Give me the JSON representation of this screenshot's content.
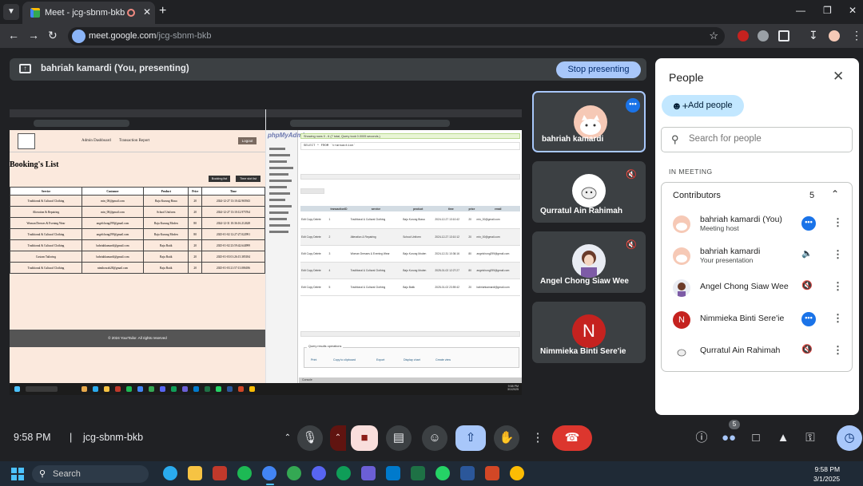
{
  "browser": {
    "tab_title": "Meet - jcg-sbnm-bkb",
    "url_host": "meet.google.com",
    "url_path": "/jcg-sbnm-bkb"
  },
  "presenting": {
    "text": "bahriah kamardi (You, presenting)",
    "stop_label": "Stop presenting"
  },
  "shared_screen": {
    "left_page": {
      "nav_items": [
        "Admin Dashboard",
        "Transaction Report"
      ],
      "logout": "Logout",
      "heading": "Booking's List",
      "buttons": [
        "Booking list",
        "Time slot list"
      ],
      "columns": [
        "Service",
        "Customer",
        "Product",
        "Price",
        "Time"
      ],
      "rows": [
        [
          "Traditional & Cultural Clothing",
          "min_00@gmail.com",
          "Baju Kurung Biasa",
          "20",
          "2024-12-27 13:10:42.965943"
        ],
        [
          "Alteration & Repairing",
          "min_00@gmail.com",
          "School Uniform",
          "20",
          "2024-12-27 13:10:12.975764"
        ],
        [
          "Woman Dresses & Evening Wear",
          "angelchong299@gmail.com",
          "Baju Kurung Moden",
          "80",
          "2024-12-31 10:36:16.212628"
        ],
        [
          "Traditional & Cultural Clothing",
          "angelchong299@gmail.com",
          "Baju Kurung Moden",
          "80",
          "2025-01-02 12:27:27.022991"
        ],
        [
          "Traditional & Cultural Clothing",
          "bahriahkamardi@gmail.com",
          "Baju Batik",
          "20",
          "2025-01-02 23:59:42.644999"
        ],
        [
          "Custom Tailoring",
          "bahriahkamardi@gmail.com",
          "Baju Batik",
          "20",
          "2025-01-03 01:26:15.385184"
        ],
        [
          "Traditional & Cultural Clothing",
          "nimthosrah28@gmail.com",
          "Baju Batik",
          "20",
          "2025-01-03 21:57:13.086186"
        ]
      ],
      "footer": "© 2024 YourTailor. All rights reserved"
    },
    "right_page": {
      "logo": "phpMyAdmin",
      "message": "Showing rows 0 - 6 (7 total, Query took 0.0005 seconds.)",
      "sql": "SELECT * FROM `transaction`",
      "columns": [
        "",
        "transactionID",
        "service",
        "product",
        "time",
        "price",
        "email"
      ],
      "rows": [
        [
          "Edit Copy Delete",
          "1",
          "Traditional & Cultural Clothing",
          "Baju Kurung Biasa",
          "2024-12-27 13:10:42",
          "20",
          "min_00@gmail.com"
        ],
        [
          "Edit Copy Delete",
          "2",
          "Alteration & Repairing",
          "School Uniform",
          "2024-12-27 13:10:12",
          "20",
          "min_00@gmail.com"
        ],
        [
          "Edit Copy Delete",
          "3",
          "Woman Dresses & Evening Wear",
          "Baju Kurung Moden",
          "2024-12-31 10:36:16",
          "80",
          "angelchong299@gmail.com"
        ],
        [
          "Edit Copy Delete",
          "4",
          "Traditional & Cultural Clothing",
          "Baju Kurung Moden",
          "2025-01-02 12:27:27",
          "80",
          "angelchong299@gmail.com"
        ],
        [
          "Edit Copy Delete",
          "5",
          "Traditional & Cultural Clothing",
          "Baju Batik",
          "2025-01-02 23:59:42",
          "20",
          "bahriahkamardi@gmail.com"
        ]
      ],
      "ops_title": "Query results operations",
      "ops": [
        "Print",
        "Copy to clipboard",
        "Export",
        "Display chart",
        "Create view"
      ],
      "console": "Console"
    },
    "taskbar_time": "9:58 PM",
    "taskbar_date": "3/1/2025"
  },
  "tiles": [
    {
      "name": "bahriah kamardi",
      "active": true
    },
    {
      "name": "Qurratul Ain Rahimah",
      "muted": true
    },
    {
      "name": "Angel Chong Siaw Wee",
      "muted": true
    },
    {
      "name": "Nimmieka Binti Sere'ie",
      "initial": "N",
      "color": "#c5221f"
    }
  ],
  "bottom_bar": {
    "time": "9:58 PM",
    "meeting_code": "jcg-sbnm-bkb",
    "people_count": "5"
  },
  "people_panel": {
    "title": "People",
    "add_people": "Add people",
    "search_placeholder": "Search for people",
    "in_meeting": "IN MEETING",
    "group_title": "Contributors",
    "group_count": "5",
    "participants": [
      {
        "name": "bahriah kamardi (You)",
        "subtitle": "Meeting host"
      },
      {
        "name": "bahriah kamardi",
        "subtitle": "Your presentation"
      },
      {
        "name": "Angel Chong Siaw Wee",
        "subtitle": ""
      },
      {
        "name": "Nimmieka Binti Sere'ie",
        "subtitle": "",
        "initial": "N"
      },
      {
        "name": "Qurratul Ain Rahimah",
        "subtitle": ""
      }
    ]
  },
  "windows_taskbar": {
    "search": "Search",
    "time": "9:58 PM",
    "date": "3/1/2025"
  }
}
